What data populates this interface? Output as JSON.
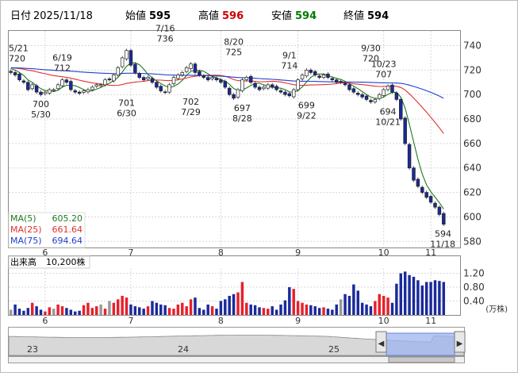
{
  "header": {
    "date_label": "日付",
    "date": "2025/11/18",
    "open_label": "始値",
    "open": "595",
    "high_label": "高値",
    "high": "596",
    "low_label": "安値",
    "low": "594",
    "close_label": "終値",
    "close": "594"
  },
  "colors": {
    "up": "#e8202a",
    "down": "#1a2a9a",
    "ma5": "#1e7a1e",
    "ma25": "#e03030",
    "ma75": "#2040d0",
    "high_text": "#cc0000",
    "low_text": "#007a00",
    "grid": "#d8d8d8",
    "axis": "#444444"
  },
  "chart_data": [
    {
      "type": "candlestick",
      "title": "",
      "x_ticks": [
        "6",
        "7",
        "8",
        "9",
        "10",
        "11"
      ],
      "y_ticks": [
        580,
        600,
        620,
        640,
        660,
        680,
        700,
        720,
        740
      ],
      "ylim": [
        575,
        752
      ],
      "price_series": [
        718,
        716,
        712,
        710,
        704,
        708,
        702,
        700,
        702,
        704,
        704,
        708,
        712,
        710,
        704,
        702,
        701,
        703,
        704,
        706,
        708,
        708,
        712,
        712,
        716,
        722,
        730,
        736,
        724,
        718,
        714,
        712,
        714,
        710,
        706,
        703,
        702,
        708,
        714,
        716,
        718,
        722,
        725,
        718,
        716,
        714,
        712,
        714,
        712,
        710,
        706,
        700,
        697,
        704,
        712,
        714,
        710,
        706,
        704,
        706,
        708,
        706,
        704,
        702,
        700,
        699,
        704,
        712,
        716,
        720,
        718,
        716,
        714,
        716,
        714,
        712,
        710,
        710,
        708,
        704,
        702,
        700,
        698,
        696,
        694,
        696,
        700,
        704,
        707,
        702,
        696,
        680,
        660,
        640,
        630,
        625,
        620,
        616,
        612,
        608,
        602,
        594
      ],
      "moving_averages": [
        {
          "name": "MA(5)",
          "value": "605.20"
        },
        {
          "name": "MA(25)",
          "value": "661.64"
        },
        {
          "name": "MA(75)",
          "value": "694.64"
        }
      ],
      "annotations": [
        {
          "date": "5/21",
          "price": "720",
          "placement": "above"
        },
        {
          "date": "5/30",
          "price": "700",
          "placement": "below"
        },
        {
          "date": "6/19",
          "price": "712",
          "placement": "above"
        },
        {
          "date": "6/30",
          "price": "701",
          "placement": "below"
        },
        {
          "date": "7/16",
          "price": "736",
          "placement": "above"
        },
        {
          "date": "7/29",
          "price": "702",
          "placement": "below"
        },
        {
          "date": "8/20",
          "price": "725",
          "placement": "above"
        },
        {
          "date": "8/28",
          "price": "697",
          "placement": "below"
        },
        {
          "date": "9/1",
          "price": "714",
          "placement": "above"
        },
        {
          "date": "9/22",
          "price": "699",
          "placement": "below"
        },
        {
          "date": "9/30",
          "price": "720",
          "placement": "above"
        },
        {
          "date": "10/21",
          "price": "694",
          "placement": "below"
        },
        {
          "date": "10/23",
          "price": "707",
          "placement": "above"
        },
        {
          "date": "11/18",
          "price": "594",
          "placement": "below"
        }
      ]
    },
    {
      "type": "bar",
      "title": "出来高",
      "volume_label": "10,200株",
      "unit": "(万株)",
      "y_ticks": [
        "0.40",
        "0.80",
        "1.20"
      ],
      "ylim": [
        0,
        1.35
      ],
      "values": [
        0.15,
        0.3,
        0.18,
        0.12,
        0.2,
        0.35,
        0.25,
        0.15,
        0.1,
        0.22,
        0.18,
        0.3,
        0.25,
        0.2,
        0.15,
        0.1,
        0.12,
        0.28,
        0.35,
        0.2,
        0.25,
        0.3,
        0.18,
        0.4,
        0.35,
        0.45,
        0.55,
        0.5,
        0.3,
        0.25,
        0.22,
        0.18,
        0.25,
        0.4,
        0.35,
        0.3,
        0.28,
        0.2,
        0.18,
        0.3,
        0.35,
        0.25,
        0.45,
        0.5,
        0.2,
        0.15,
        0.3,
        0.25,
        0.18,
        0.4,
        0.45,
        0.55,
        0.6,
        0.65,
        0.95,
        0.35,
        0.3,
        0.28,
        0.22,
        0.2,
        0.18,
        0.25,
        0.15,
        0.3,
        0.42,
        0.8,
        0.75,
        0.4,
        0.35,
        0.3,
        0.28,
        0.25,
        0.2,
        0.22,
        0.18,
        0.15,
        0.3,
        0.45,
        0.6,
        0.55,
        0.88,
        0.7,
        0.35,
        0.3,
        0.25,
        0.4,
        0.6,
        0.55,
        0.5,
        0.35,
        0.9,
        1.2,
        1.25,
        1.15,
        1.1,
        1.0,
        0.85,
        0.95,
        0.95,
        1.0,
        0.98,
        0.95
      ]
    }
  ],
  "navigator": {
    "labels": [
      "23",
      "24",
      "25"
    ],
    "left_arrow": "◀",
    "right_arrow": "▶"
  }
}
